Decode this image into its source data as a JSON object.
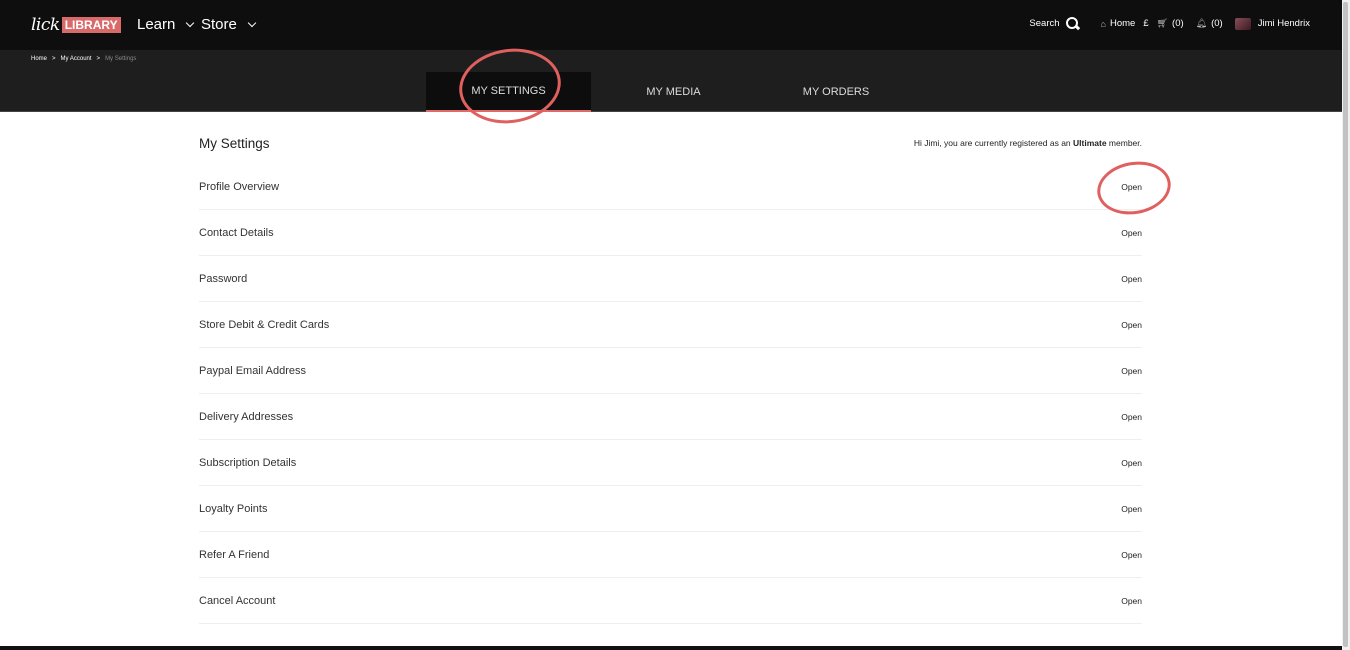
{
  "header": {
    "logo_left": "lick",
    "logo_right": "LIBRARY",
    "nav": [
      {
        "label": "Learn"
      },
      {
        "label": "Store"
      }
    ],
    "search_label": "Search",
    "home_label": "Home",
    "currency": "£",
    "cart_count": "(0)",
    "notifications_count": "(0)",
    "user_name": "Jimi Hendrix"
  },
  "breadcrumb": {
    "items": [
      "Home",
      "My Account",
      "My Settings"
    ],
    "separator": ">"
  },
  "tabs": [
    {
      "label": "MY SETTINGS",
      "active": true
    },
    {
      "label": "MY MEDIA",
      "active": false
    },
    {
      "label": "MY ORDERS",
      "active": false
    }
  ],
  "settings": {
    "title": "My Settings",
    "greeting_prefix": "Hi Jimi, you are currently registered as an ",
    "membership": "Ultimate",
    "greeting_suffix": " member.",
    "open_label": "Open",
    "rows": [
      {
        "label": "Profile Overview"
      },
      {
        "label": "Contact Details"
      },
      {
        "label": "Password"
      },
      {
        "label": "Store Debit & Credit Cards"
      },
      {
        "label": "Paypal Email Address"
      },
      {
        "label": "Delivery Addresses"
      },
      {
        "label": "Subscription Details"
      },
      {
        "label": "Loyalty Points"
      },
      {
        "label": "Refer A Friend"
      },
      {
        "label": "Cancel Account"
      }
    ]
  },
  "colors": {
    "brand_accent": "#d96a6a",
    "header_bg": "#0e0e0e",
    "subbar_bg": "#1e1e1e",
    "annotation": "#e06060"
  }
}
